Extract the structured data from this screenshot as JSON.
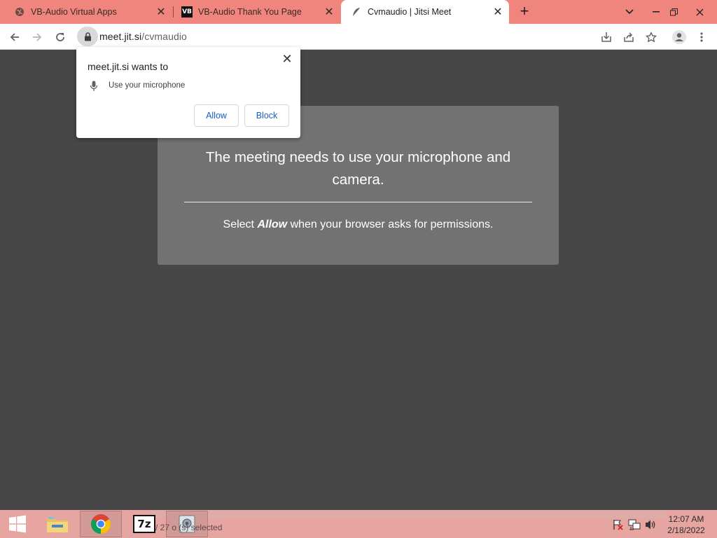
{
  "browser": {
    "tabs": [
      {
        "label": "VB-Audio Virtual Apps",
        "favicon": "globe-icon",
        "active": false
      },
      {
        "label": "VB-Audio Thank You Page",
        "favicon": "vb-audio-icon",
        "active": false
      },
      {
        "label": "Cvmaudio | Jitsi Meet",
        "favicon": "jitsi-icon",
        "active": true
      }
    ],
    "vb_favicon_text": "VB",
    "url_host": "meet.jit.si",
    "url_path": "/cvmaudio"
  },
  "permission_popup": {
    "title": "meet.jit.si wants to",
    "item": "Use your microphone",
    "allow_label": "Allow",
    "block_label": "Block"
  },
  "meeting": {
    "heading": "The meeting needs to use your microphone and camera.",
    "sub_prefix": "Select ",
    "sub_emph": "Allow",
    "sub_suffix": " when your browser asks for permissions."
  },
  "taskbar": {
    "ghost_text": "/ 27 o     (s) selected",
    "sevenzip_label": "7z",
    "time": "12:07 AM",
    "date": "2/18/2022"
  },
  "colors": {
    "tab_strip": "#f0857d",
    "page_bg": "#474747",
    "overlay": "#727272",
    "taskbar": "#e7a5a1",
    "link_blue": "#1a5fc4"
  }
}
